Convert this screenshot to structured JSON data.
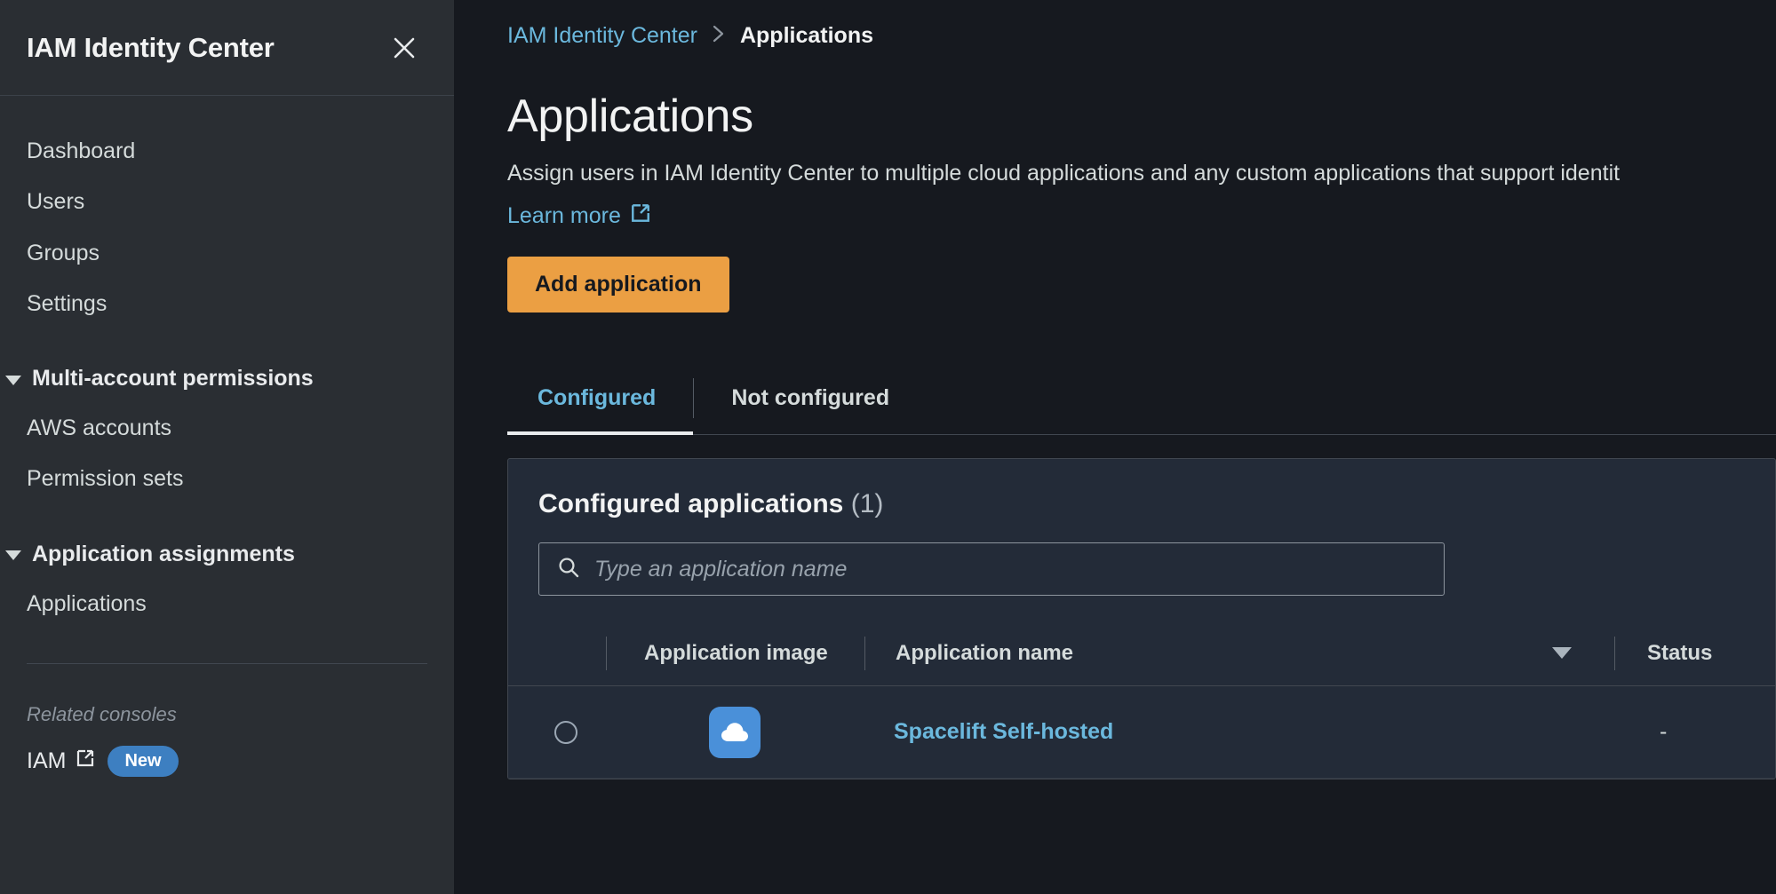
{
  "sidebar": {
    "title": "IAM Identity Center",
    "close_icon": "close-icon",
    "nav": [
      {
        "label": "Dashboard"
      },
      {
        "label": "Users"
      },
      {
        "label": "Groups"
      },
      {
        "label": "Settings"
      }
    ],
    "sections": [
      {
        "label": "Multi-account permissions",
        "items": [
          {
            "label": "AWS accounts"
          },
          {
            "label": "Permission sets"
          }
        ]
      },
      {
        "label": "Application assignments",
        "items": [
          {
            "label": "Applications"
          }
        ]
      }
    ],
    "related": {
      "title": "Related consoles",
      "link_label": "IAM",
      "external_icon": "external-link-icon",
      "badge": "New",
      "badge_color": "#3d7fc1"
    }
  },
  "breadcrumb": {
    "root": "IAM Identity Center",
    "separator": "›",
    "current": "Applications"
  },
  "page": {
    "title": "Applications",
    "description": "Assign users in IAM Identity Center to multiple cloud applications and any custom applications that support identit",
    "learn_more": "Learn more",
    "learn_more_icon": "external-link-icon",
    "primary_button": "Add application",
    "primary_button_color": "#eb9f43"
  },
  "tabs": [
    {
      "label": "Configured",
      "active": true
    },
    {
      "label": "Not configured",
      "active": false
    }
  ],
  "panel": {
    "title": "Configured applications",
    "count": "(1)",
    "search": {
      "placeholder": "Type an application name",
      "value": "",
      "icon": "search-icon"
    },
    "table": {
      "columns": [
        {
          "key": "select",
          "label": ""
        },
        {
          "key": "image",
          "label": "Application image"
        },
        {
          "key": "name",
          "label": "Application name",
          "sort": "descending",
          "sort_icon": "sort-descending-icon"
        },
        {
          "key": "status",
          "label": "Status"
        }
      ],
      "rows": [
        {
          "selected": false,
          "icon": "cloud-icon",
          "icon_bg": "#4a90d9",
          "name": "Spacelift Self-hosted",
          "status": "-"
        }
      ]
    }
  },
  "colors": {
    "accent_link": "#6bb8dd",
    "sidebar_bg": "#2a2e33",
    "main_bg": "#16191f",
    "panel_bg": "#232b38"
  }
}
